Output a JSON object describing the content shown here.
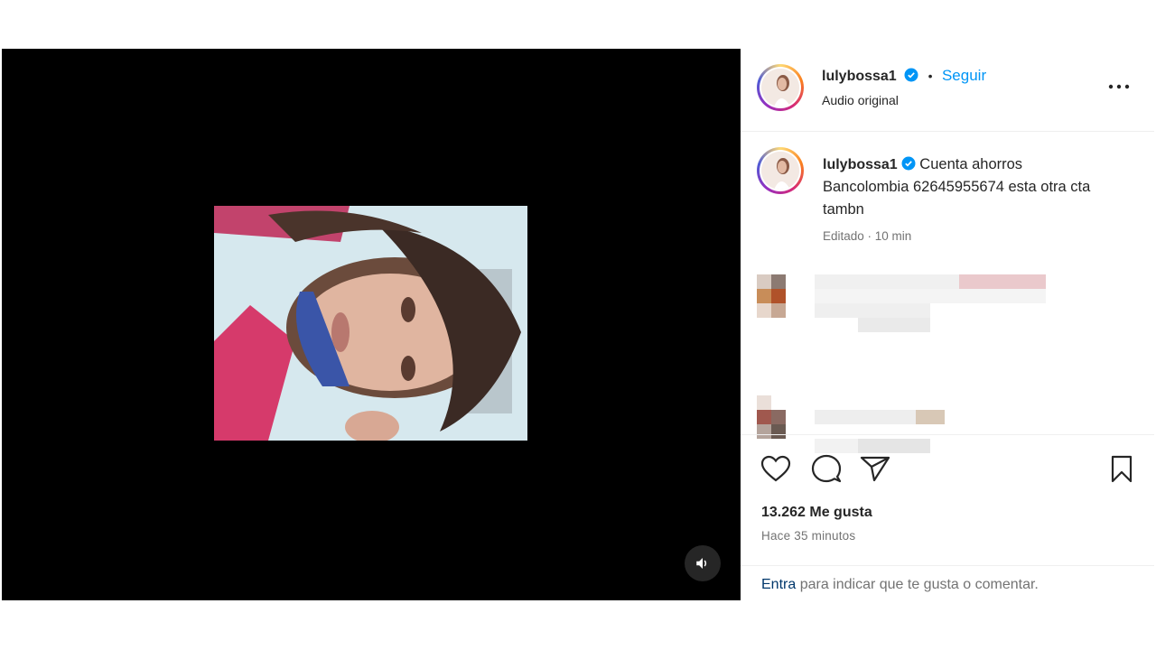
{
  "post": {
    "username": "lulybossa1",
    "follow_label": "Seguir",
    "separator": "•",
    "audio_label": "Audio original",
    "caption": {
      "username": "lulybossa1",
      "text": "Cuenta ahorros Bancolombia 62645955674 esta otra cta tambn",
      "meta": "Editado · 10 min"
    },
    "likes": "13.262 Me gusta",
    "time": "Hace 35 minutos",
    "login_prompt": {
      "link": "Entra",
      "text": " para indicar que te gusta o comentar."
    }
  },
  "icons": {
    "verified": "verified-badge-icon",
    "more": "more-options-icon",
    "like": "heart-icon",
    "comment": "comment-icon",
    "share": "send-icon",
    "save": "bookmark-icon",
    "mute": "volume-icon"
  },
  "colors": {
    "accent": "#0095f6",
    "verified": "#0095f6",
    "media_bg": "#000000",
    "secondary_text": "#737373"
  }
}
